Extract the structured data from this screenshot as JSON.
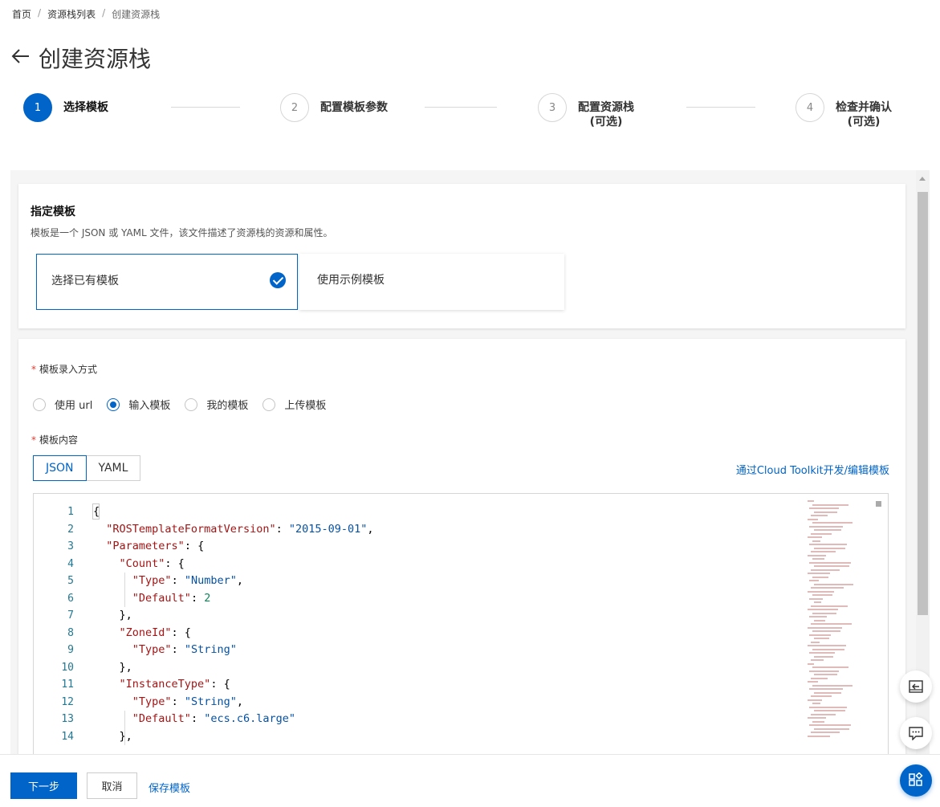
{
  "breadcrumb": {
    "home": "首页",
    "list": "资源栈列表",
    "current": "创建资源栈",
    "sep": "/"
  },
  "header": {
    "back_icon": "arrow-left-icon",
    "title": "创建资源栈"
  },
  "steps": [
    {
      "num": "1",
      "label": "选择模板",
      "label2": "",
      "active": true
    },
    {
      "num": "2",
      "label": "配置模板参数",
      "label2": "",
      "active": false
    },
    {
      "num": "3",
      "label": "配置资源栈",
      "label2": "(可选)",
      "active": false
    },
    {
      "num": "4",
      "label": "检查并确认",
      "label2": "(可选)",
      "active": false
    }
  ],
  "template_card": {
    "heading": "指定模板",
    "description": "模板是一个 JSON 或 YAML 文件，该文件描述了资源栈的资源和属性。",
    "options": [
      {
        "label": "选择已有模板",
        "selected": true
      },
      {
        "label": "使用示例模板",
        "selected": false
      }
    ]
  },
  "entry": {
    "required_mark": "*",
    "label": "模板录入方式",
    "options": [
      {
        "label": "使用 url",
        "checked": false
      },
      {
        "label": "输入模板",
        "checked": true
      },
      {
        "label": "我的模板",
        "checked": false
      },
      {
        "label": "上传模板",
        "checked": false
      }
    ]
  },
  "content": {
    "required_mark": "*",
    "label": "模板内容",
    "tabs": [
      {
        "label": "JSON",
        "active": true
      },
      {
        "label": "YAML",
        "active": false
      }
    ],
    "toolkit_link": "通过Cloud Toolkit开发/编辑模板"
  },
  "editor": {
    "line_numbers": [
      "1",
      "2",
      "3",
      "4",
      "5",
      "6",
      "7",
      "8",
      "9",
      "10",
      "11",
      "12",
      "13",
      "14"
    ],
    "lines": [
      "{",
      "  \"ROSTemplateFormatVersion\": \"2015-09-01\",",
      "  \"Parameters\": {",
      "    \"Count\": {",
      "      \"Type\": \"Number\",",
      "      \"Default\": 2",
      "    },",
      "    \"ZoneId\": {",
      "      \"Type\": \"String\"",
      "    },",
      "    \"InstanceType\": {",
      "      \"Type\": \"String\",",
      "      \"Default\": \"ecs.c6.large\"",
      "    },"
    ]
  },
  "footer": {
    "next": "下一步",
    "cancel": "取消",
    "save": "保存模板"
  },
  "floating": [
    "collapse-panel-icon",
    "chat-icon",
    "apps-icon"
  ],
  "colors": {
    "accent": "#0064c8",
    "required": "#e03c31",
    "json_key": "#a31515",
    "json_string": "#0451a5",
    "json_number": "#098658"
  }
}
